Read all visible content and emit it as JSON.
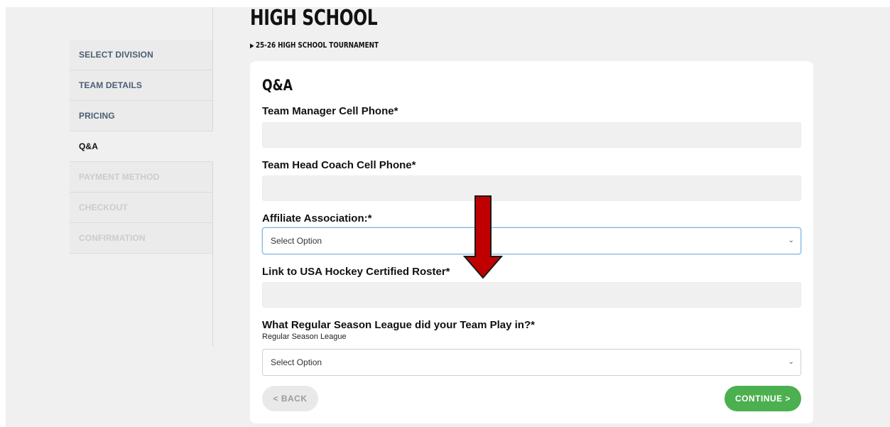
{
  "sidebar": {
    "items": [
      {
        "label": "SELECT DIVISION",
        "state": "completed"
      },
      {
        "label": "TEAM DETAILS",
        "state": "completed"
      },
      {
        "label": "PRICING",
        "state": "completed"
      },
      {
        "label": "Q&A",
        "state": "active"
      },
      {
        "label": "PAYMENT METHOD",
        "state": "disabled"
      },
      {
        "label": "CHECKOUT",
        "state": "disabled"
      },
      {
        "label": "CONFIRMATION",
        "state": "disabled"
      }
    ]
  },
  "header": {
    "title": "HIGH SCHOOL",
    "breadcrumb": "25-26 HIGH SCHOOL TOURNAMENT"
  },
  "form": {
    "title": "Q&A",
    "fields": [
      {
        "label": "Team Manager Cell Phone*",
        "type": "text",
        "value": ""
      },
      {
        "label": "Team Head Coach Cell Phone*",
        "type": "text",
        "value": ""
      },
      {
        "label": "Affiliate Association:*",
        "type": "select",
        "value": "Select Option"
      },
      {
        "label": "Link to USA Hockey Certified Roster*",
        "type": "text",
        "value": ""
      },
      {
        "label": "What Regular Season League did your Team Play in?*",
        "sublabel": "Regular Season League",
        "type": "select",
        "value": "Select Option"
      }
    ],
    "back_label": "BACK",
    "continue_label": "CONTINUE"
  },
  "icons": {
    "chevron": "chevron-down-icon",
    "back": "chevron-left-icon",
    "continue": "chevron-right-icon",
    "annotation": "down-arrow-icon"
  },
  "colors": {
    "continue": "#4caf50",
    "annotation_arrow": "#c00000",
    "focus_border": "#7eb6e8"
  }
}
